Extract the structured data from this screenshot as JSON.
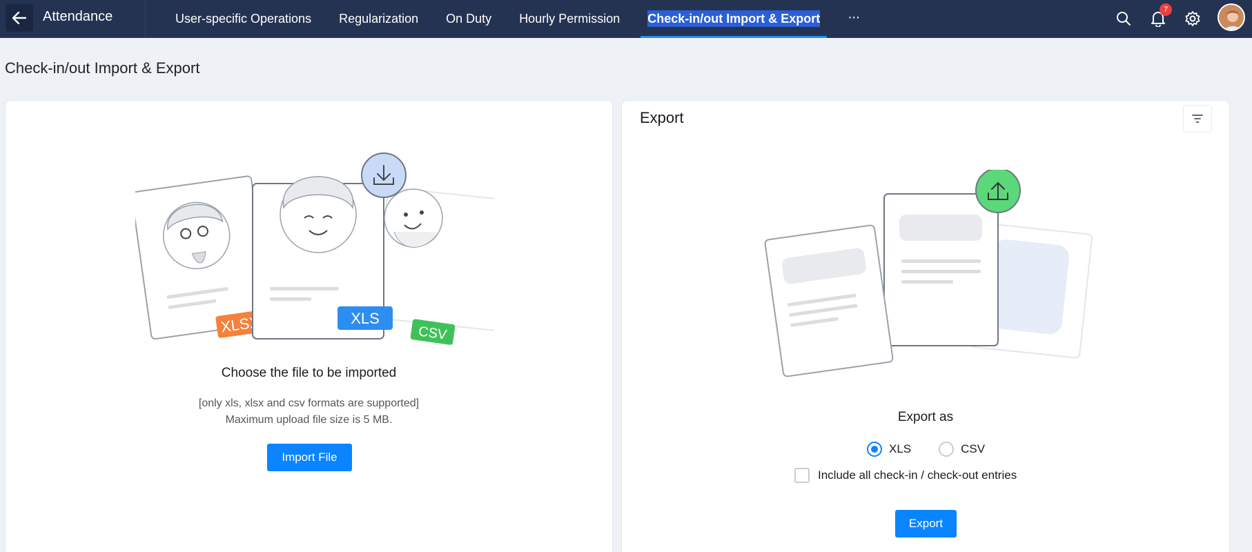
{
  "header": {
    "back_icon": "arrow-left-icon",
    "app_title": "Attendance",
    "tabs": [
      {
        "label": "User-specific Operations",
        "active": false
      },
      {
        "label": "Regularization",
        "active": false
      },
      {
        "label": "On Duty",
        "active": false
      },
      {
        "label": "Hourly Permission",
        "active": false
      },
      {
        "label": "Check-in/out Import & Export",
        "active": true
      }
    ],
    "more_label": "···",
    "notification_count": "7",
    "icons": [
      "search-icon",
      "bell-icon",
      "gear-icon",
      "avatar"
    ],
    "colors": {
      "topbar": "#253353",
      "accent": "#0a84ff",
      "badge": "#ef3e3e"
    }
  },
  "page_title": "Check-in/out Import & Export",
  "import_panel": {
    "file_badges": [
      "XLSX",
      "XLS",
      "CSV"
    ],
    "title": "Choose the file to be imported",
    "hint_line1": "[only xls, xlsx and csv formats are supported]",
    "hint_line2": "Maximum upload file size is 5 MB.",
    "button_label": "Import File"
  },
  "export_panel": {
    "title": "Export",
    "filter_icon": "filter-icon",
    "export_as_label": "Export as",
    "formats": [
      {
        "label": "XLS",
        "selected": true
      },
      {
        "label": "CSV",
        "selected": false
      }
    ],
    "include_all_label": "Include all check-in / check-out entries",
    "include_all_checked": false,
    "button_label": "Export"
  }
}
